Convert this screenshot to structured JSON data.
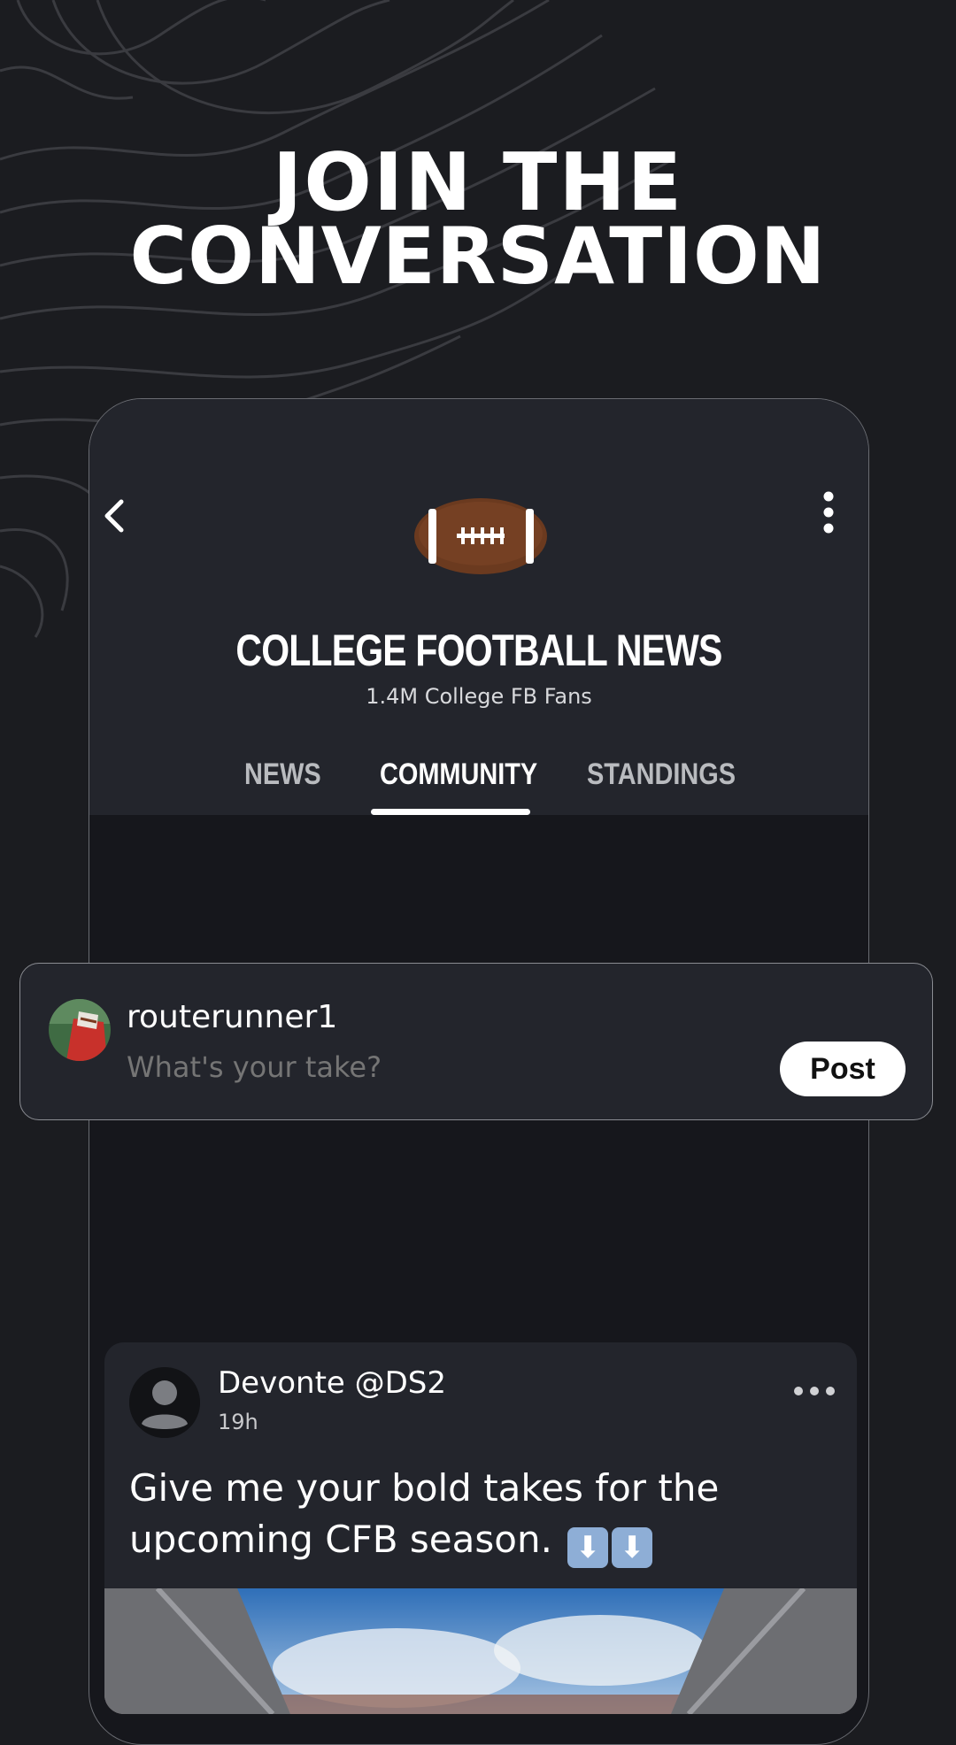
{
  "headline": {
    "line1": "JOIN THE",
    "line2": "CONVERSATION"
  },
  "group": {
    "title": "COLLEGE FOOTBALL NEWS",
    "subtitle": "1.4M College FB Fans"
  },
  "tabs": [
    {
      "label": "NEWS",
      "active": false
    },
    {
      "label": "COMMUNITY",
      "active": true
    },
    {
      "label": "STANDINGS",
      "active": false
    }
  ],
  "composer": {
    "username": "routerunner1",
    "placeholder": "What's your take?",
    "post_label": "Post"
  },
  "post": {
    "author": "Devonte @DS2",
    "time": "19h",
    "text": "Give me your bold takes for the upcoming CFB season.",
    "emoji": [
      "⬇",
      "⬇"
    ]
  },
  "icons": {
    "back": "chevron-left-icon",
    "more": "vertical-ellipsis-icon",
    "post_more": "horizontal-ellipsis-icon",
    "logo": "football-icon"
  },
  "colors": {
    "background": "#1b1c20",
    "header": "#23252c",
    "feed": "#16171c",
    "football": "#6b3a1f"
  }
}
